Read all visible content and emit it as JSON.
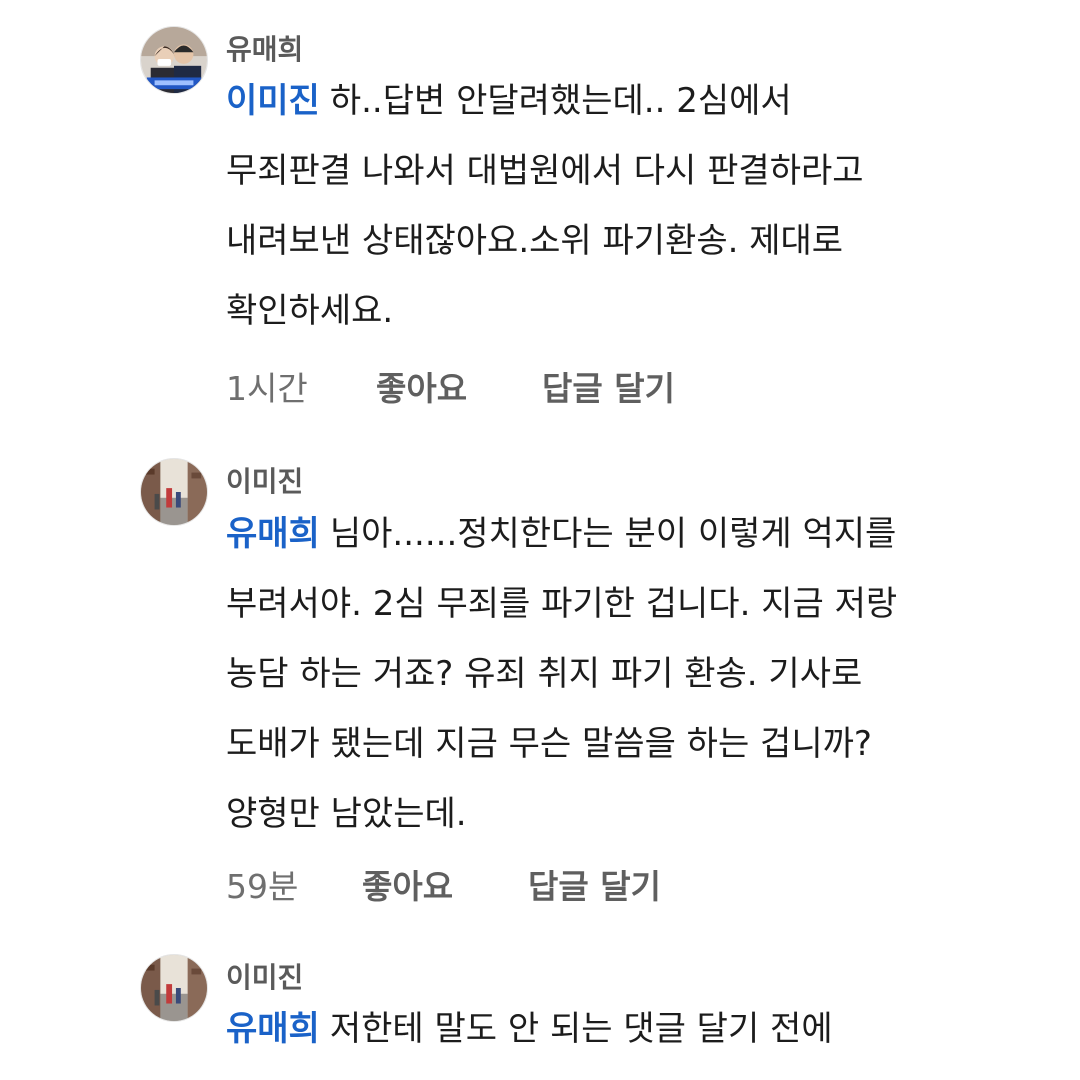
{
  "comments": [
    {
      "author": "유매희",
      "mention": "이미진",
      "lines": [
        "하..답변 안달려했는데.. 2심에서",
        "무죄판결 나와서 대법원에서 다시 판결하라고",
        "내려보낸 상태잖아요.소위 파기환송. 제대로",
        "확인하세요."
      ],
      "time": "1시간",
      "like_label": "좋아요",
      "reply_label": "답글 달기"
    },
    {
      "author": "이미진",
      "mention": "유매희",
      "lines": [
        "님아......정치한다는 분이 이렇게 억지를",
        "부려서야. 2심 무죄를 파기한 겁니다. 지금 저랑",
        "농담 하는 거죠? 유죄 취지 파기 환송. 기사로",
        "도배가 됐는데 지금 무슨 말씀을 하는 겁니까?",
        "양형만 남았는데."
      ],
      "time": "59분",
      "like_label": "좋아요",
      "reply_label": "답글 달기"
    },
    {
      "author": "이미진",
      "mention": "유매희",
      "lines": [
        "저한테 말도 안 되는 댓글 달기 전에"
      ]
    }
  ],
  "colors": {
    "mention": "#1a62c8",
    "author": "#5a5a5a",
    "meta": "#6f6f6f"
  }
}
